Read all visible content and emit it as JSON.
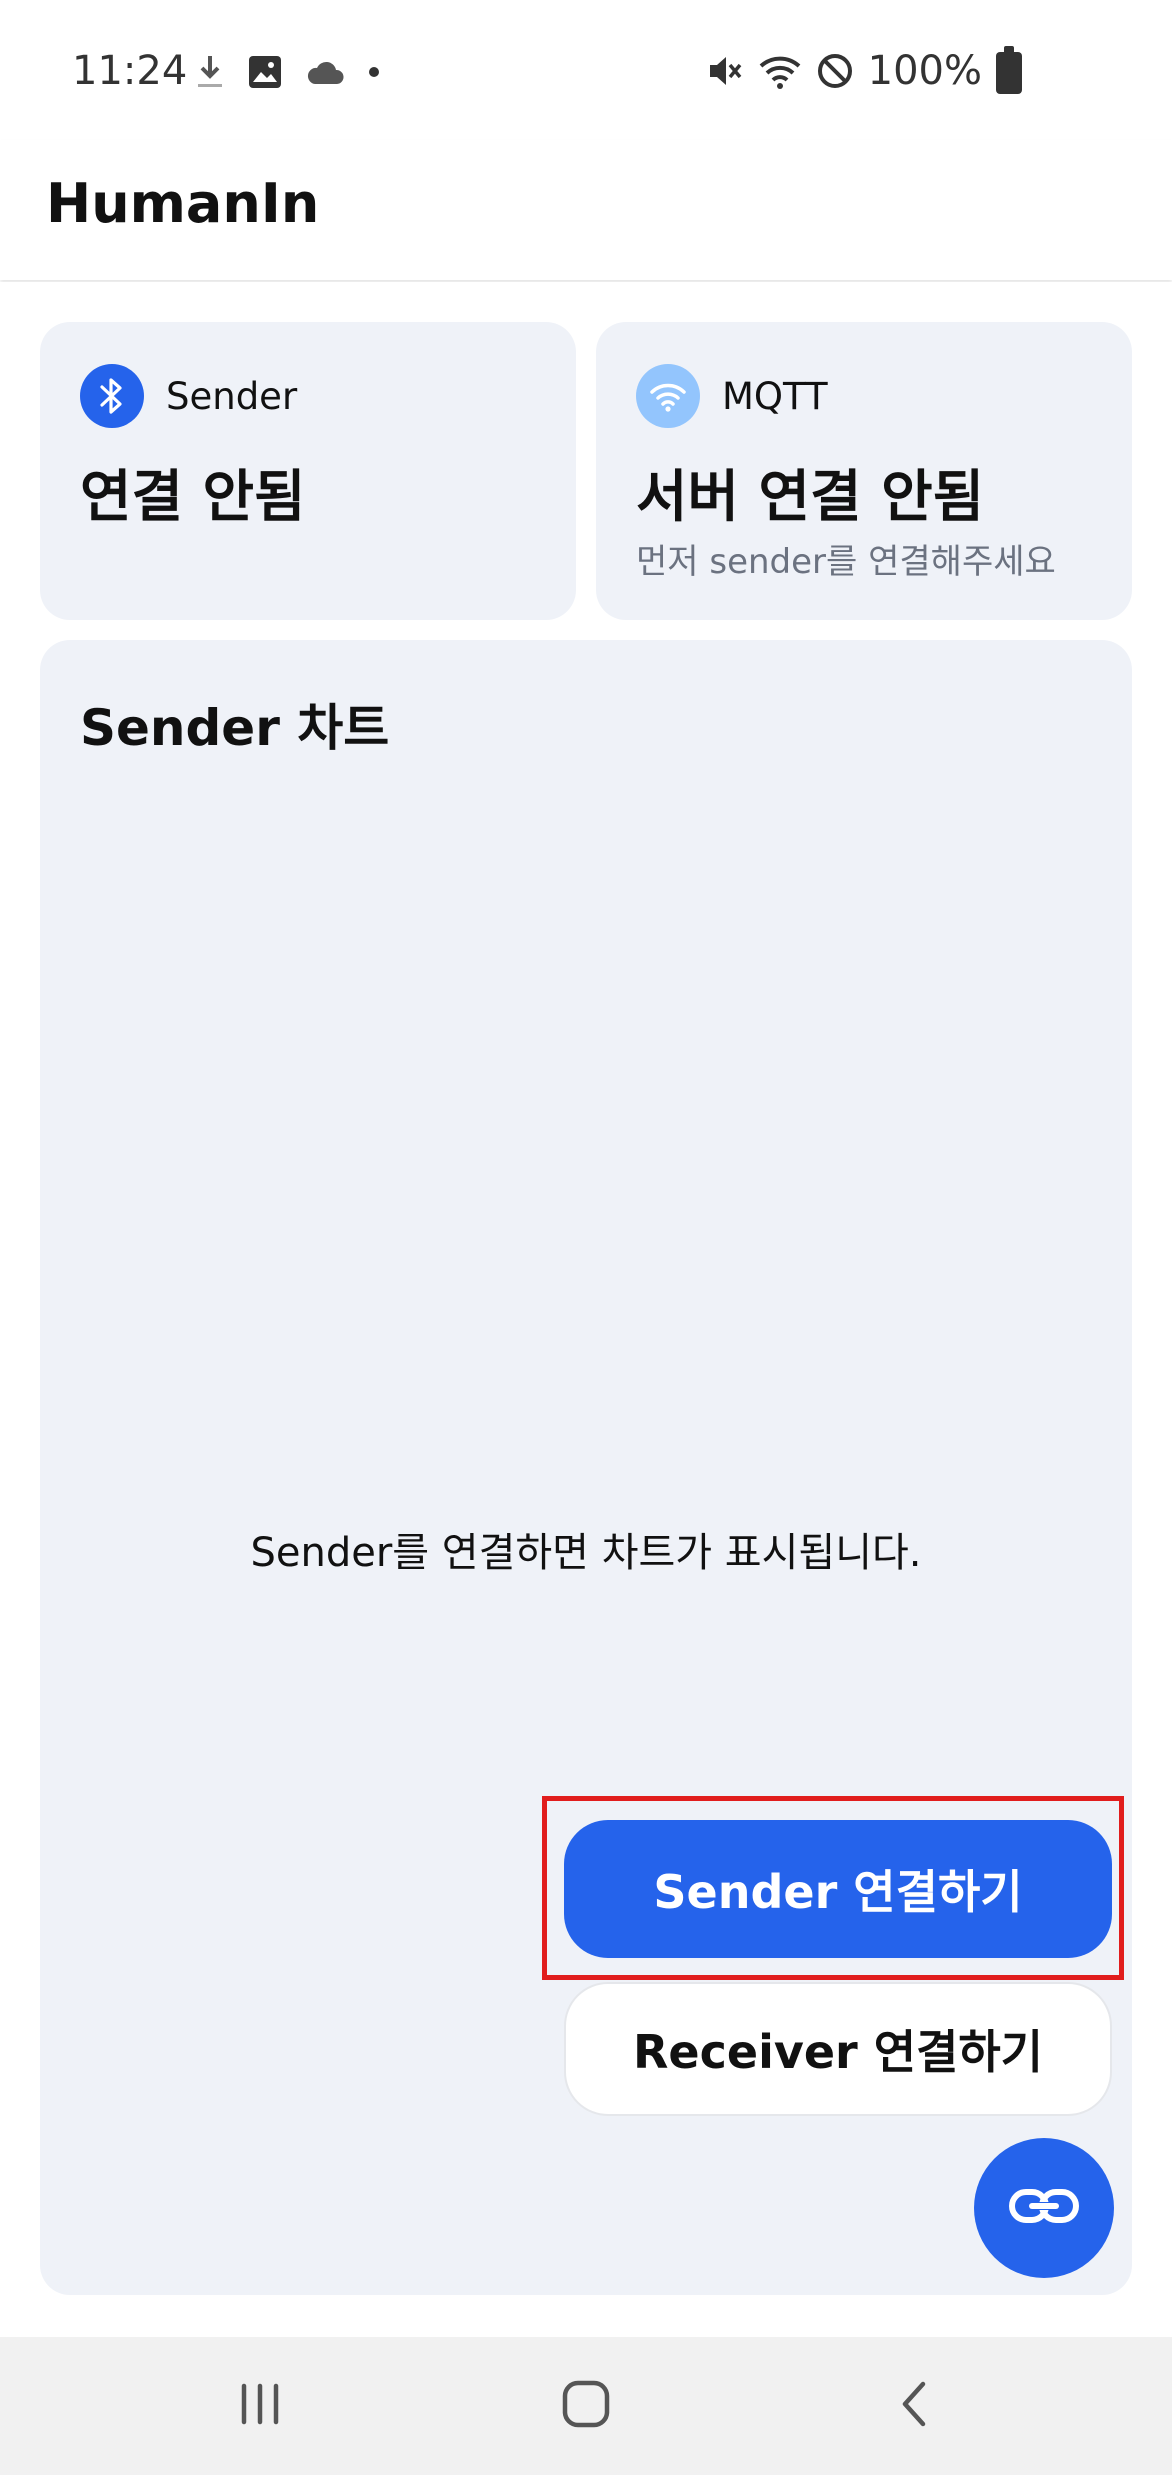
{
  "status_bar": {
    "time": "11:24",
    "battery_percent": "100%",
    "icons_left": [
      "download-icon",
      "image-icon",
      "cloud-icon",
      "dot-icon"
    ],
    "icons_right": [
      "mute-icon",
      "wifi-icon",
      "no-signal-icon",
      "battery-icon"
    ]
  },
  "app_bar": {
    "title": "HumanIn"
  },
  "sender_card": {
    "icon": "bluetooth-icon",
    "label": "Sender",
    "status": "연결 안됨"
  },
  "mqtt_card": {
    "icon": "wifi-icon",
    "label": "MQTT",
    "status": "서버 연결 안됨",
    "subtitle": "먼저 sender를 연결해주세요"
  },
  "chart_card": {
    "title": "Sender 차트",
    "empty_message": "Sender를 연결하면 차트가 표시됩니다."
  },
  "actions": {
    "sender_button": "Sender 연결하기",
    "receiver_button": "Receiver 연결하기",
    "fab_icon": "link-icon"
  },
  "nav_bar": {
    "items": [
      "recent-apps-icon",
      "home-icon",
      "back-icon"
    ]
  },
  "colors": {
    "primary": "#2563eb",
    "card_bg": "#eff2f8",
    "wifi_icon_bg": "#93c5fd",
    "highlight": "#e11d1d"
  }
}
